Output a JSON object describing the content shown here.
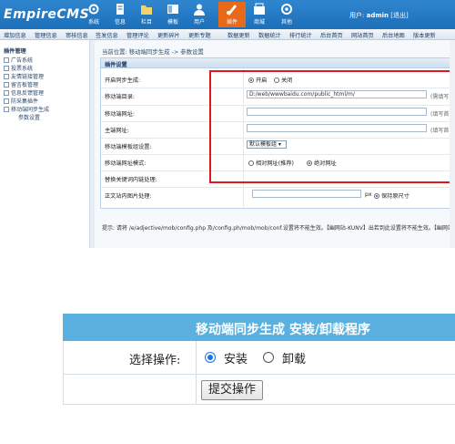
{
  "admin": {
    "logo": "EmpireCMS",
    "toolbar": [
      {
        "label": "系统",
        "icon": "gear-icon"
      },
      {
        "label": "信息",
        "icon": "document-icon"
      },
      {
        "label": "栏目",
        "icon": "folder-icon"
      },
      {
        "label": "模板",
        "icon": "template-icon"
      },
      {
        "label": "用户",
        "icon": "user-icon"
      },
      {
        "label": "插件",
        "icon": "plugin-icon"
      },
      {
        "label": "商城",
        "icon": "shop-icon"
      },
      {
        "label": "其他",
        "icon": "other-icon"
      }
    ],
    "user_prefix": "用户:",
    "user_name": "admin",
    "logout": "[退出]",
    "menu": [
      "增加信息",
      "管理信息",
      "审核信息",
      "签发信息",
      "管理评论",
      "更新碎片",
      "更新专题",
      "数据更新",
      "数据统计",
      "排行统计",
      "后台首页",
      "网站首页",
      "后台地图",
      "版本更新"
    ],
    "sidebar": {
      "title": "插件管理",
      "items": [
        "广告系统",
        "投票系统",
        "友情链接管理",
        "留言板管理",
        "信息反馈管理",
        "防采集插件",
        "移动端同步生成"
      ],
      "sub_item": "参数设置"
    },
    "breadcrumb": "当前位置: 移动端同步生成 -> 参数设置",
    "form": {
      "header": "插件设置",
      "rows": [
        {
          "label": "开启同步生成:"
        },
        {
          "label": "移动端目录:"
        },
        {
          "label": "移动端网址:"
        },
        {
          "label": "主端网址:"
        },
        {
          "label": "移动端模板组设置:"
        },
        {
          "label": "移动端网址模式:"
        },
        {
          "label": "替换关键词内链处理:"
        },
        {
          "label": "正文站内图片处理:"
        }
      ],
      "open_on": "开启",
      "open_off": "关闭",
      "mobile_dir_value": "D:/web/wwwbaidu.com/public_html/m/",
      "mobile_dir_hint": "(需填写",
      "mobile_url_hint": "(填写首",
      "main_url_hint": "(填写首",
      "template_select": "默认模板组",
      "mode_relative": "相对网址(推荐)",
      "mode_absolute": "绝对网址",
      "px_label": "px",
      "keep_original": "保持原尺寸"
    },
    "tip": "提示: 请将 /e/adjective/mob/config.php 及/config.ph/mob/mob/conf.设置将不能生效。【幽网站-KUNV】出若到此设置将不能生效。【幽网站-KUNV】"
  },
  "uninstall": {
    "title": "移动端同步生成 安装/卸载程序",
    "choose_label": "选择操作:",
    "option_install": "安装",
    "option_uninstall": "卸载",
    "submit": "提交操作",
    "install_checked": true
  }
}
